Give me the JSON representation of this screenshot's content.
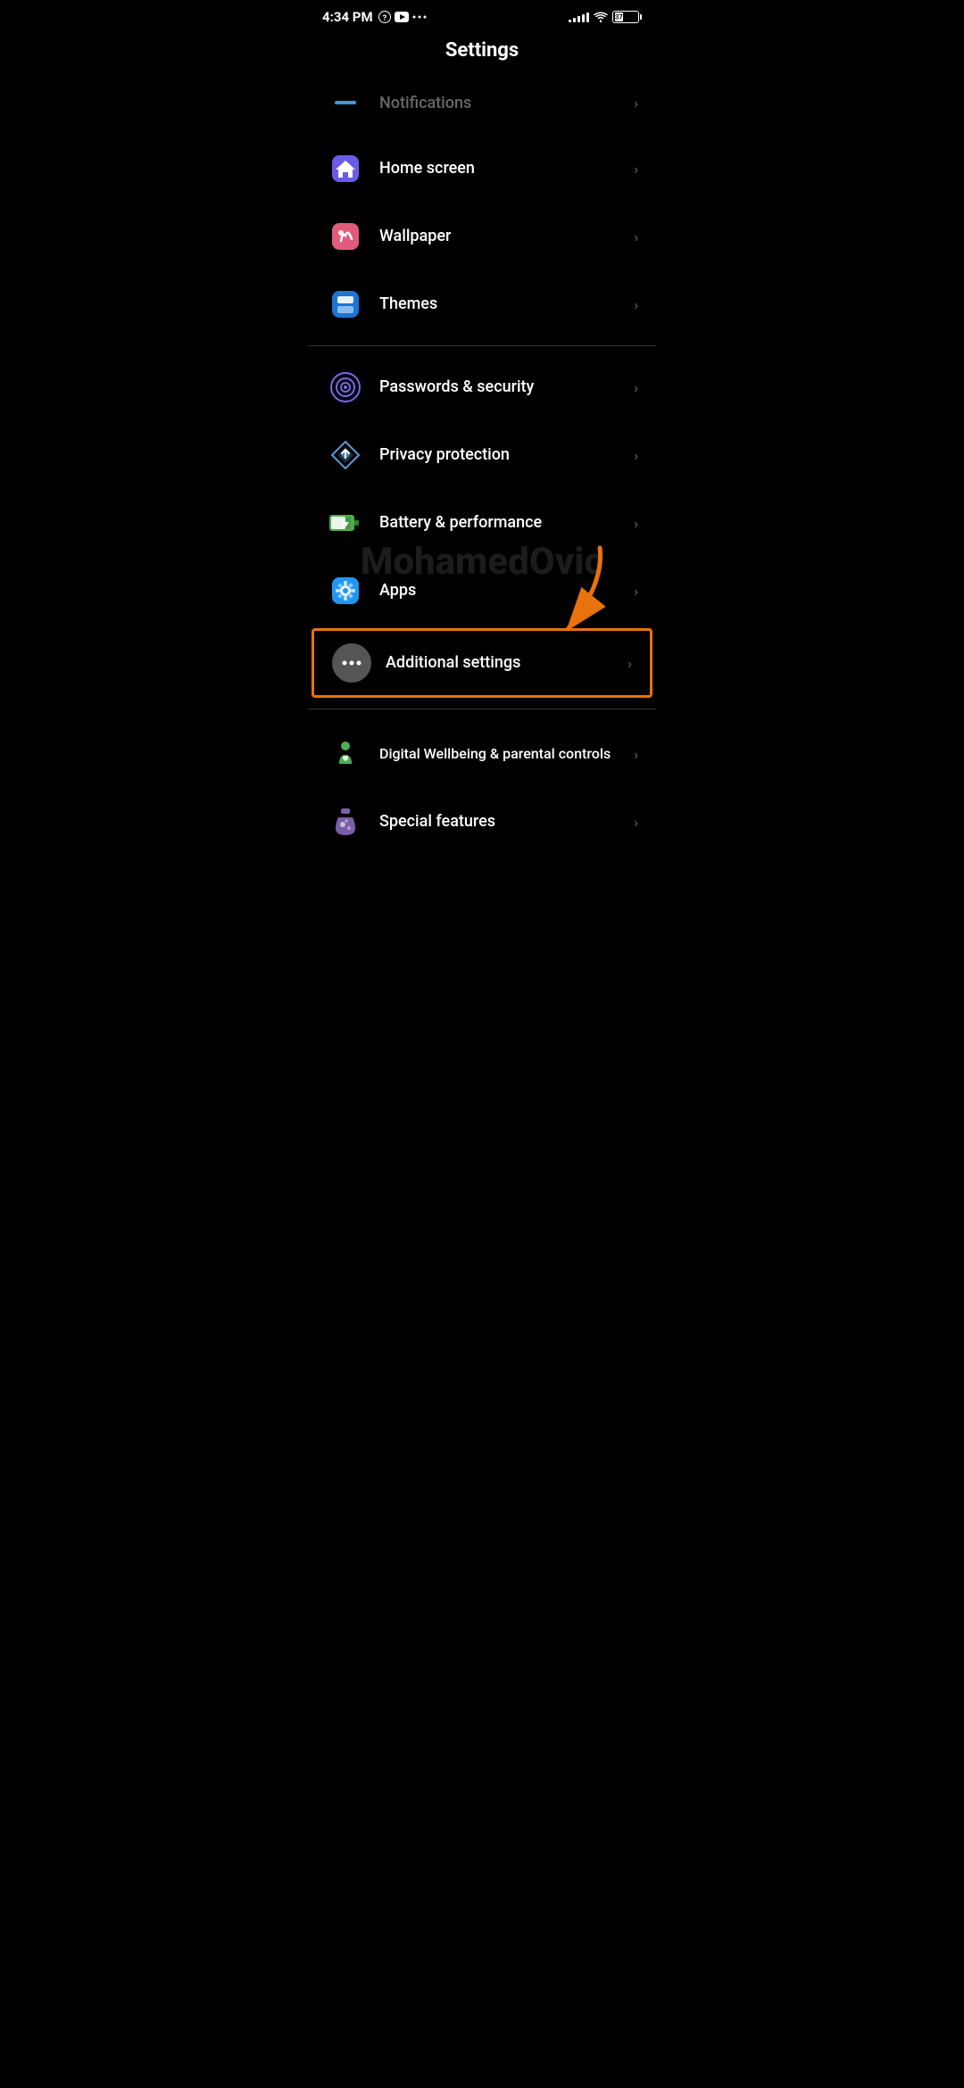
{
  "statusBar": {
    "time": "4:34 PM",
    "battery": "37",
    "icons": [
      "question-mark",
      "youtube",
      "more"
    ]
  },
  "pageTitle": "Settings",
  "watermark": "MohamedOvic",
  "items": [
    {
      "id": "notifications",
      "label": "Notifications",
      "partial": true,
      "iconColor": "#4A90E2",
      "iconType": "notifications"
    },
    {
      "id": "home-screen",
      "label": "Home screen",
      "iconColor": "#6B5CE7",
      "iconType": "home"
    },
    {
      "id": "wallpaper",
      "label": "Wallpaper",
      "iconColor": "#E05C7A",
      "iconType": "wallpaper"
    },
    {
      "id": "themes",
      "label": "Themes",
      "iconColor": "#4A90E2",
      "iconType": "themes"
    },
    {
      "id": "passwords-security",
      "label": "Passwords & security",
      "iconColor": "#7B68EE",
      "iconType": "passwords"
    },
    {
      "id": "privacy-protection",
      "label": "Privacy protection",
      "iconColor": "#5B9BD5",
      "iconType": "privacy"
    },
    {
      "id": "battery-performance",
      "label": "Battery & performance",
      "iconColor": "#4CAF50",
      "iconType": "battery"
    },
    {
      "id": "apps",
      "label": "Apps",
      "iconColor": "#2196F3",
      "iconType": "apps"
    },
    {
      "id": "additional-settings",
      "label": "Additional settings",
      "iconColor": "#888",
      "iconType": "additional",
      "highlighted": true
    },
    {
      "id": "digital-wellbeing",
      "label": "Digital Wellbeing & parental controls",
      "iconColor": "#4CAF50",
      "iconType": "wellbeing"
    },
    {
      "id": "special-features",
      "label": "Special features",
      "iconColor": "#7B5EA7",
      "iconType": "special"
    }
  ]
}
